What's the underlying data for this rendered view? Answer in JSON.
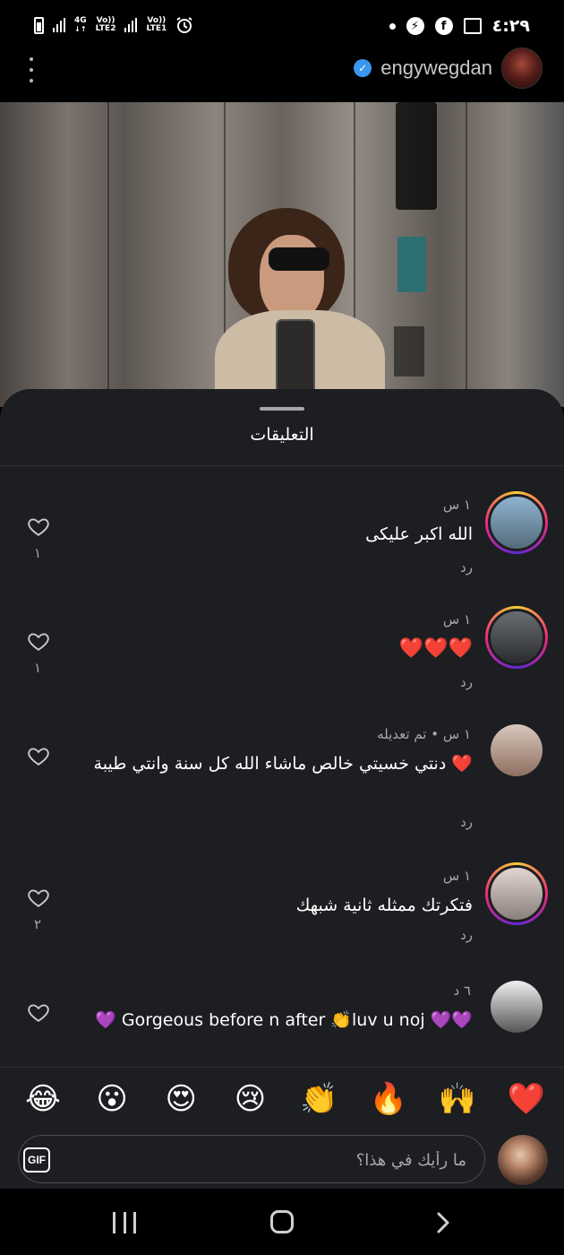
{
  "status_bar": {
    "left_network_1": "4G",
    "left_network_1_sub": "",
    "volte_1": "Vo))",
    "lte_1": "LTE2",
    "volte_2": "Vo))",
    "lte_2": "LTE1",
    "time": "٤:٢٩",
    "icons": [
      "battery-icon",
      "signal-icon",
      "alarm-icon",
      "dot-icon",
      "messenger-icon",
      "facebook-icon",
      "gallery-icon"
    ]
  },
  "header": {
    "username": "engywegdan",
    "verified": true
  },
  "comments_sheet": {
    "title": "التعليقات",
    "comments": [
      {
        "time": "١ س",
        "text": "الله اكبر عليكى",
        "reply": "رد",
        "likes": "١",
        "avatar_color": "#6f8fa8"
      },
      {
        "time": "١ س",
        "text": "❤️❤️❤️",
        "reply": "رد",
        "likes": "١",
        "avatar_color": "#3a3d3f"
      },
      {
        "time": "١ س • تم تعديله",
        "text": "دنتي خسيتي خالص ماشاء الله كل سنة وانتي طيبة ❤️",
        "reply": "رد",
        "likes": "",
        "avatar_color": "#b49a8a"
      },
      {
        "time": "١ س",
        "text": "فتكرتك ممثله ثانية شبهك",
        "reply": "رد",
        "likes": "٢",
        "avatar_color": "#b2a6a2"
      },
      {
        "time": "٦ د",
        "text": "💜💜 Gorgeous before n after 👏luv u noj 💜",
        "reply": "",
        "likes": "",
        "avatar_color": "#7b7470"
      }
    ]
  },
  "reactions": [
    "❤️",
    "🙌",
    "🔥",
    "👏",
    "😢",
    "😍",
    "😮",
    "😂"
  ],
  "composer": {
    "gif_label": "GIF",
    "placeholder": "ما رأيك في هذا؟"
  }
}
